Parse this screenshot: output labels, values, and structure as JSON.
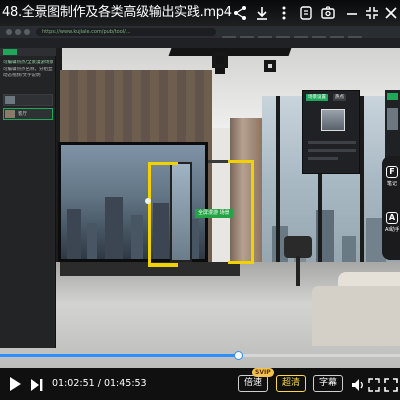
{
  "header": {
    "title": "48.全景图制作及各类高级输出实践.mp4",
    "icons": [
      "share-icon",
      "download-icon",
      "more-icon",
      "clip-icon",
      "fullscreen-exit-icon",
      "settings-icon",
      "close-icon"
    ]
  },
  "video_content": {
    "browser_url": "https://www.kujiale.com/pub/tool/...",
    "editor_left": {
      "heading": "可编辑热点/全景漫游场景",
      "hint_line1": "可编辑热点名称，分组显示",
      "hint_line2": "动态视频/文字说明",
      "item_label": "客厅"
    },
    "editor_right": {
      "tab_active": "场景设置",
      "tab_inactive": "热点"
    },
    "hotspot_tag": "全屏漫游 场景",
    "side_buttons": [
      {
        "icon": "AI-feature-icon",
        "glyph": "F",
        "label": "笔记"
      },
      {
        "icon": "ai-assistant-icon",
        "glyph": "A",
        "label": "AI助手"
      }
    ]
  },
  "player": {
    "current_time": "01:02:51",
    "total_time": "01:45:53",
    "time_separator": "/",
    "progress": 0.594,
    "buttons": {
      "speed": "倍速",
      "speed_badge": "SVIP",
      "quality": "超清",
      "subtitle": "字幕"
    },
    "accent_color": "#2f8fff"
  }
}
